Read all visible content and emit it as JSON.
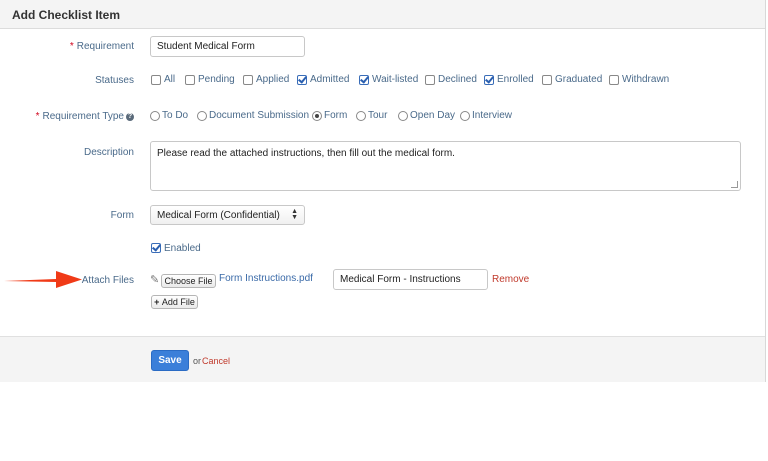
{
  "header": {
    "title": "Add Checklist Item"
  },
  "requirement": {
    "label": "Requirement",
    "required_mark": "*",
    "value": "Student Medical Form"
  },
  "statuses": {
    "label": "Statuses",
    "options": [
      {
        "label": "All",
        "checked": false
      },
      {
        "label": "Pending",
        "checked": false
      },
      {
        "label": "Applied",
        "checked": false
      },
      {
        "label": "Admitted",
        "checked": true
      },
      {
        "label": "Wait-listed",
        "checked": true
      },
      {
        "label": "Declined",
        "checked": false
      },
      {
        "label": "Enrolled",
        "checked": true
      },
      {
        "label": "Graduated",
        "checked": false
      },
      {
        "label": "Withdrawn",
        "checked": false
      }
    ]
  },
  "requirement_type": {
    "label": "Requirement Type",
    "required_mark": "*",
    "help_icon": "question-circle-icon",
    "options": [
      {
        "label": "To Do",
        "selected": false
      },
      {
        "label": "Document Submission",
        "selected": false
      },
      {
        "label": "Form",
        "selected": true
      },
      {
        "label": "Tour",
        "selected": false
      },
      {
        "label": "Open Day",
        "selected": false
      },
      {
        "label": "Interview",
        "selected": false
      }
    ]
  },
  "description": {
    "label": "Description",
    "value": "Please read the attached instructions, then fill out the medical form."
  },
  "form": {
    "label": "Form",
    "selected": "Medical Form (Confidential)"
  },
  "enabled": {
    "label": "Enabled",
    "checked": true
  },
  "attach_files": {
    "label": "Attach Files",
    "choose_button": "Choose File",
    "file_name": "Form Instructions.pdf",
    "title_value": "Medical Form - Instructions",
    "remove_label": "Remove",
    "add_file_label": "Add File",
    "add_icon": "plus-icon",
    "attach_icon": "paperclip-icon"
  },
  "footer": {
    "save_label": "Save",
    "or_text": "or",
    "cancel_label": "Cancel"
  },
  "annotation": {
    "arrow_color": "#f03a17"
  },
  "colors": {
    "accent": "#3b7fd9",
    "label": "#4a6a8a",
    "danger": "#c0392b"
  }
}
